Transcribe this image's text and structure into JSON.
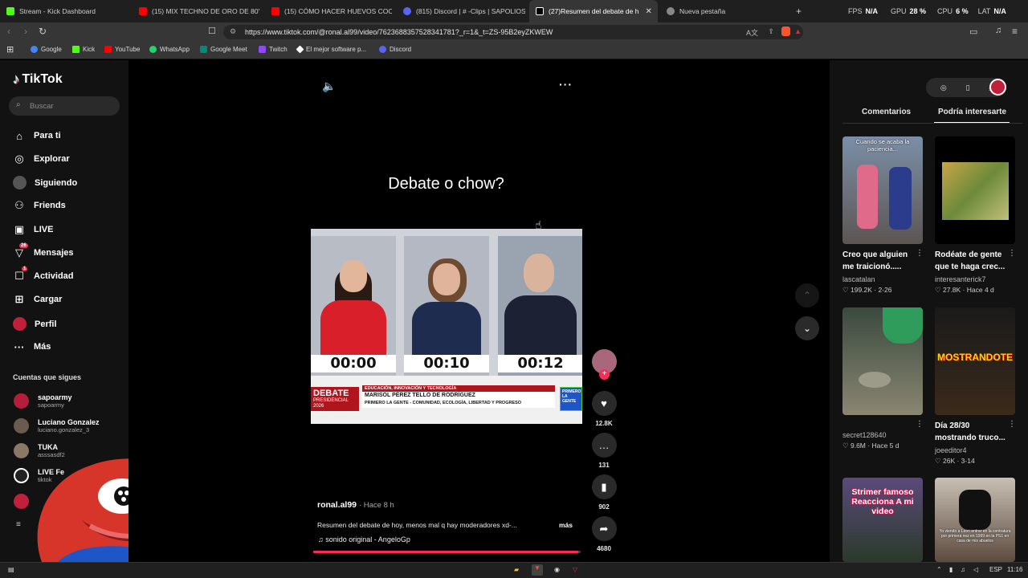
{
  "browser": {
    "tabs": [
      {
        "title": "Stream - Kick Dashboard",
        "color": "#53fc18"
      },
      {
        "title": "(15) MIX TECHNO DE ORO DE 80's &",
        "color": "#ff0000"
      },
      {
        "title": "(15) CÓMO HACER HUEVOS COCIDO",
        "color": "#ff0000"
      },
      {
        "title": "(815) Discord | # -Clips | SAPOLIOS",
        "color": "#5865f2"
      },
      {
        "title": "(27)Resumen del debate de h",
        "color": "#ffffff"
      },
      {
        "title": "Nueva pestaña",
        "color": "#888888"
      }
    ],
    "new_tab": "+",
    "stats": {
      "fps_label": "FPS",
      "fps_value": "N/A",
      "gpu_label": "GPU",
      "gpu_value": "28 %",
      "cpu_label": "CPU",
      "cpu_value": "6 %",
      "lat_label": "LAT",
      "lat_value": "N/A"
    },
    "url": "https://www.tiktok.com/@ronal.al99/video/7623688357528341781?_r=1&_t=ZS-95B2eyZKWEW",
    "bookmarks": [
      {
        "label": "Google",
        "color": "#4285f4"
      },
      {
        "label": "Kick",
        "color": "#53fc18"
      },
      {
        "label": "YouTube",
        "color": "#ff0000"
      },
      {
        "label": "WhatsApp",
        "color": "#25d366"
      },
      {
        "label": "Google Meet",
        "color": "#00897b"
      },
      {
        "label": "Twitch",
        "color": "#9146ff"
      },
      {
        "label": "El mejor software p...",
        "color": "#ffffff"
      },
      {
        "label": "Discord",
        "color": "#5865f2"
      }
    ]
  },
  "tiktok": {
    "logo": "TikTok",
    "search_placeholder": "Buscar",
    "nav": [
      {
        "label": "Para ti",
        "icon": "home-icon"
      },
      {
        "label": "Explorar",
        "icon": "compass-icon"
      },
      {
        "label": "Siguiendo",
        "icon": "following-icon"
      },
      {
        "label": "Friends",
        "icon": "friends-icon"
      },
      {
        "label": "LIVE",
        "icon": "live-icon"
      },
      {
        "label": "Mensajes",
        "icon": "messages-icon",
        "badge": "26"
      },
      {
        "label": "Actividad",
        "icon": "activity-icon",
        "badge": "1"
      },
      {
        "label": "Cargar",
        "icon": "upload-icon"
      },
      {
        "label": "Perfil",
        "icon": "profile-icon"
      },
      {
        "label": "Más",
        "icon": "more-icon"
      }
    ],
    "following_title": "Cuentas que sigues",
    "following": [
      {
        "name": "sapoarmy",
        "user": "sapoarmy"
      },
      {
        "name": "Luciano Gonzalez",
        "user": "luciano.gonzalez_3"
      },
      {
        "name": "TUKA",
        "user": "asssasdf2"
      },
      {
        "name": "LIVE Fe",
        "user": "tiktok"
      }
    ],
    "video": {
      "caption_overlay": "Debate o chow?",
      "timers": [
        "00:00",
        "00:10",
        "00:12"
      ],
      "banner_left": "DEBATE",
      "banner_left_sub": "PRESIDENCIAL",
      "banner_year": "2026",
      "banner_topic": "EDUCACIÓN, INNOVACIÓN Y TECNOLOGÍA",
      "banner_name": "MARISOL PÉREZ TELLO DE RODRÍGUEZ",
      "banner_party": "PRIMERO LA GENTE - COMUNIDAD, ECOLOGÍA, LIBERTAD Y PROGRESO",
      "banner_right": "PRIMERO LA GENTE",
      "author": "ronal.al99",
      "time": "· Hace 8 h",
      "description": "Resumen del debate de hoy, menos mal q hay moderadores xd-...",
      "more": "más",
      "sound": "sonido original - AngeloGp",
      "progress": 0.99
    },
    "actions": {
      "likes": "12.8K",
      "comments": "131",
      "saves": "902",
      "shares": "4680"
    },
    "right_tabs": {
      "comments": "Comentarios",
      "related": "Podría interesarte"
    },
    "cards": [
      {
        "title": "Creo que alguien me traicionó.....",
        "user": "lascatalan",
        "likes": "199.2K",
        "date": "2-26",
        "overlay": "Cuando se acaba la paciencia..."
      },
      {
        "title": "Rodéate de gente que te haga crec...",
        "user": "interesanterick7",
        "likes": "27.8K",
        "date": "Hace 4 d",
        "overlay": ""
      },
      {
        "title": "",
        "user": "secret128640",
        "likes": "9.6M",
        "date": "Hace 5 d",
        "overlay": ""
      },
      {
        "title": "Día 28/30 mostrando truco...",
        "user": "joeeditor4",
        "likes": "26K",
        "date": "3-14",
        "overlay": "MOSTRANDOTE"
      },
      {
        "title": "",
        "user": "",
        "likes": "",
        "date": "",
        "overlay": "Strimer famoso Reacciona A mi video"
      },
      {
        "title": "",
        "user": "",
        "likes": "",
        "date": "",
        "overlay": "Yo viendo a Leon entrar en la contratura por primera vez en 1999 en la PS1 en casa de mis abuelos"
      }
    ]
  },
  "taskbar": {
    "lang": "ESP",
    "time": "11:16"
  }
}
